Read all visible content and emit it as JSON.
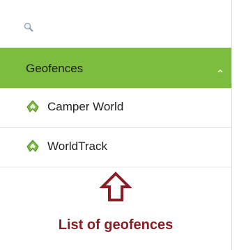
{
  "search": {
    "icon": "search-icon"
  },
  "group": {
    "title": "Geofences",
    "state_icon": "chevron-up-icon"
  },
  "geofences": [
    {
      "label": "Camper World",
      "icon": "geofence-icon"
    },
    {
      "label": "WorldTrack",
      "icon": "geofence-icon"
    }
  ],
  "annotation": {
    "text": "List of geofences",
    "icon": "arrow-up-icon"
  },
  "colors": {
    "group_header_bg": "#7cbd3f",
    "geofence_icon": "#7cbd3f",
    "annotation": "#8b1c24"
  }
}
